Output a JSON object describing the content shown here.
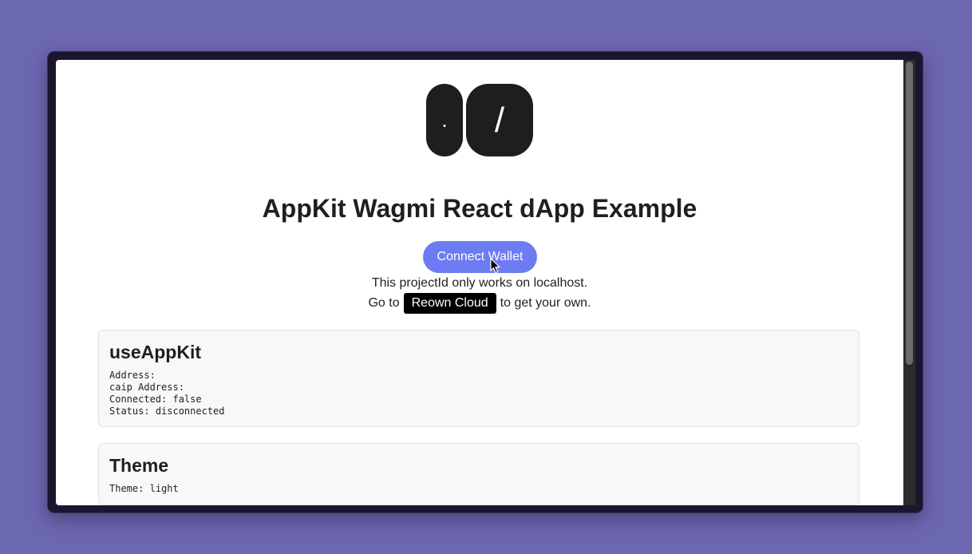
{
  "logo": {
    "left_glyph": ".",
    "right_glyph": "/"
  },
  "page": {
    "title": "AppKit Wagmi React dApp Example"
  },
  "connect": {
    "label": "Connect Wallet"
  },
  "notice": {
    "line1": "This projectId only works on localhost.",
    "go_to": "Go to",
    "link_label": "Reown Cloud",
    "suffix": "to get your own."
  },
  "appkit_card": {
    "title": "useAppKit",
    "address_label": "Address:",
    "address_value": "",
    "caip_label": "caip Address:",
    "caip_value": "",
    "connected_label": "Connected:",
    "connected_value": "false",
    "status_label": "Status:",
    "status_value": "disconnected"
  },
  "theme_card": {
    "title": "Theme",
    "theme_label": "Theme:",
    "theme_value": "light"
  },
  "colors": {
    "background": "#6c67b1",
    "button": "#6d7cf2",
    "logo": "#1e1e1e"
  }
}
